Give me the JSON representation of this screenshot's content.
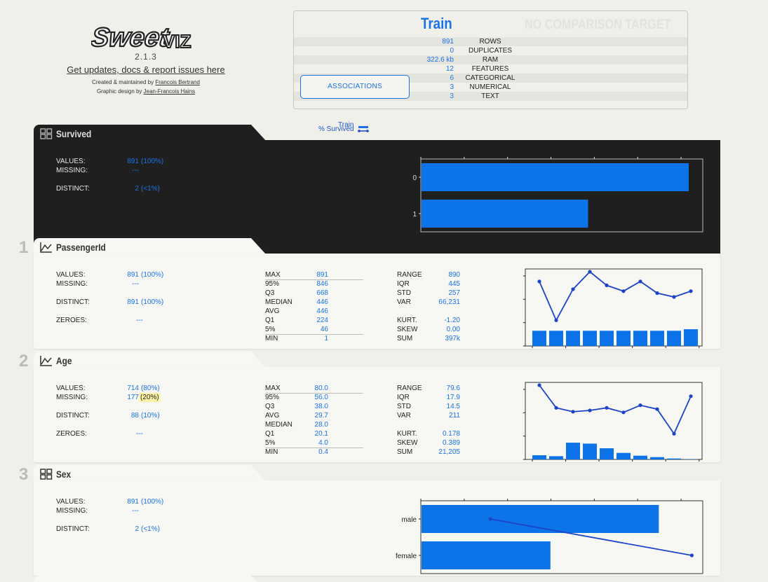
{
  "header": {
    "logo_text": "SweetVIZ",
    "version": "2.1.3",
    "updates_link": "Get updates, docs & report issues here",
    "created_by_prefix": "Created & maintained by ",
    "created_by_name": "Francois Bertrand",
    "design_prefix": "Graphic design by ",
    "design_name": "Jean-Francois Hains"
  },
  "summary": {
    "train_label": "Train",
    "comparison_label": "NO COMPARISON TARGET",
    "associations_button": "ASSOCIATIONS",
    "rows": [
      {
        "value": "891",
        "label": "ROWS"
      },
      {
        "value": "0",
        "label": "DUPLICATES"
      },
      {
        "value": "322.6 kb",
        "label": "RAM"
      },
      {
        "value": "12",
        "label": "FEATURES"
      },
      {
        "value": "6",
        "label": "CATEGORICAL"
      },
      {
        "value": "3",
        "label": "NUMERICAL"
      },
      {
        "value": "3",
        "label": "TEXT"
      }
    ]
  },
  "target_legend": {
    "line1": "Train",
    "line2": "% Survived"
  },
  "colors": {
    "accent": "#1a73e8",
    "bar": "#0d73e8",
    "line": "#1c44c8",
    "dark_panel": "#201f1f",
    "light_panel": "#f7f7f4",
    "highlight": "#fff3a8"
  },
  "features": [
    {
      "name": "Survived",
      "type_icon": "categorical-icon",
      "index": "",
      "values": "891",
      "values_pct": "(100%)",
      "missing": "---",
      "missing_pct": "",
      "distinct": "2",
      "distinct_pct": "(<1%)"
    },
    {
      "name": "PassengerId",
      "type_icon": "numerical-icon",
      "index": "1",
      "values": "891",
      "values_pct": "(100%)",
      "missing": "---",
      "missing_pct": "",
      "distinct": "891",
      "distinct_pct": "(100%)",
      "zeroes": "---",
      "stats1": [
        [
          "MAX",
          "891"
        ],
        [
          "95%",
          "846"
        ],
        [
          "Q3",
          "668"
        ],
        [
          "MEDIAN",
          "446"
        ],
        [
          "AVG",
          "446"
        ],
        [
          "Q1",
          "224"
        ],
        [
          "5%",
          "46"
        ],
        [
          "MIN",
          "1"
        ]
      ],
      "stats2": [
        [
          "RANGE",
          "890"
        ],
        [
          "IQR",
          "445"
        ],
        [
          "STD",
          "257"
        ],
        [
          "VAR",
          "66,231"
        ]
      ],
      "stats3": [
        [
          "KURT.",
          "-1.20"
        ],
        [
          "SKEW",
          "0.00"
        ],
        [
          "SUM",
          "397k"
        ]
      ]
    },
    {
      "name": "Age",
      "type_icon": "numerical-icon",
      "index": "2",
      "values": "714",
      "values_pct": "(80%)",
      "missing": "177",
      "missing_pct": "(20%)",
      "distinct": "88",
      "distinct_pct": "(10%)",
      "zeroes": "---",
      "stats1": [
        [
          "MAX",
          "80.0"
        ],
        [
          "95%",
          "56.0"
        ],
        [
          "Q3",
          "38.0"
        ],
        [
          "AVG",
          "29.7"
        ],
        [
          "MEDIAN",
          "28.0"
        ],
        [
          "Q1",
          "20.1"
        ],
        [
          "5%",
          "4.0"
        ],
        [
          "MIN",
          "0.4"
        ]
      ],
      "stats2": [
        [
          "RANGE",
          "79.6"
        ],
        [
          "IQR",
          "17.9"
        ],
        [
          "STD",
          "14.5"
        ],
        [
          "VAR",
          "211"
        ]
      ],
      "stats3": [
        [
          "KURT.",
          "0.178"
        ],
        [
          "SKEW",
          "0.389"
        ],
        [
          "SUM",
          "21,205"
        ]
      ]
    },
    {
      "name": "Sex",
      "type_icon": "categorical-icon",
      "index": "3",
      "values": "891",
      "values_pct": "(100%)",
      "missing": "---",
      "missing_pct": "",
      "distinct": "2",
      "distinct_pct": "(<1%)"
    }
  ],
  "labels": {
    "values": "VALUES:",
    "missing": "MISSING:",
    "distinct": "DISTINCT:",
    "zeroes": "ZEROES:"
  },
  "chart_data": [
    {
      "type": "bar",
      "orientation": "horizontal",
      "feature": "Survived",
      "categories": [
        "0",
        "1"
      ],
      "values": [
        61.6,
        38.4
      ],
      "xlim": [
        0,
        65
      ]
    },
    {
      "type": "bar",
      "feature": "PassengerId",
      "bars": [
        10,
        10,
        10,
        10,
        10,
        10,
        10,
        10,
        10,
        11
      ],
      "line": [
        2,
        0,
        1.6,
        2.5,
        1.8,
        1.5,
        2.0,
        1.4,
        1.2,
        1.5
      ]
    },
    {
      "type": "bar",
      "feature": "Age",
      "bars": [
        4.5,
        3.5,
        18,
        17,
        12,
        7,
        4,
        2.5,
        1,
        0.3
      ],
      "line": [
        75,
        40,
        34,
        36,
        40,
        33,
        44,
        38,
        0,
        58
      ]
    },
    {
      "type": "bar",
      "orientation": "horizontal",
      "feature": "Sex",
      "categories": [
        "male",
        "female"
      ],
      "values": [
        64.8,
        35.2
      ],
      "line": [
        19,
        74
      ],
      "xlim": [
        0,
        77
      ]
    }
  ]
}
